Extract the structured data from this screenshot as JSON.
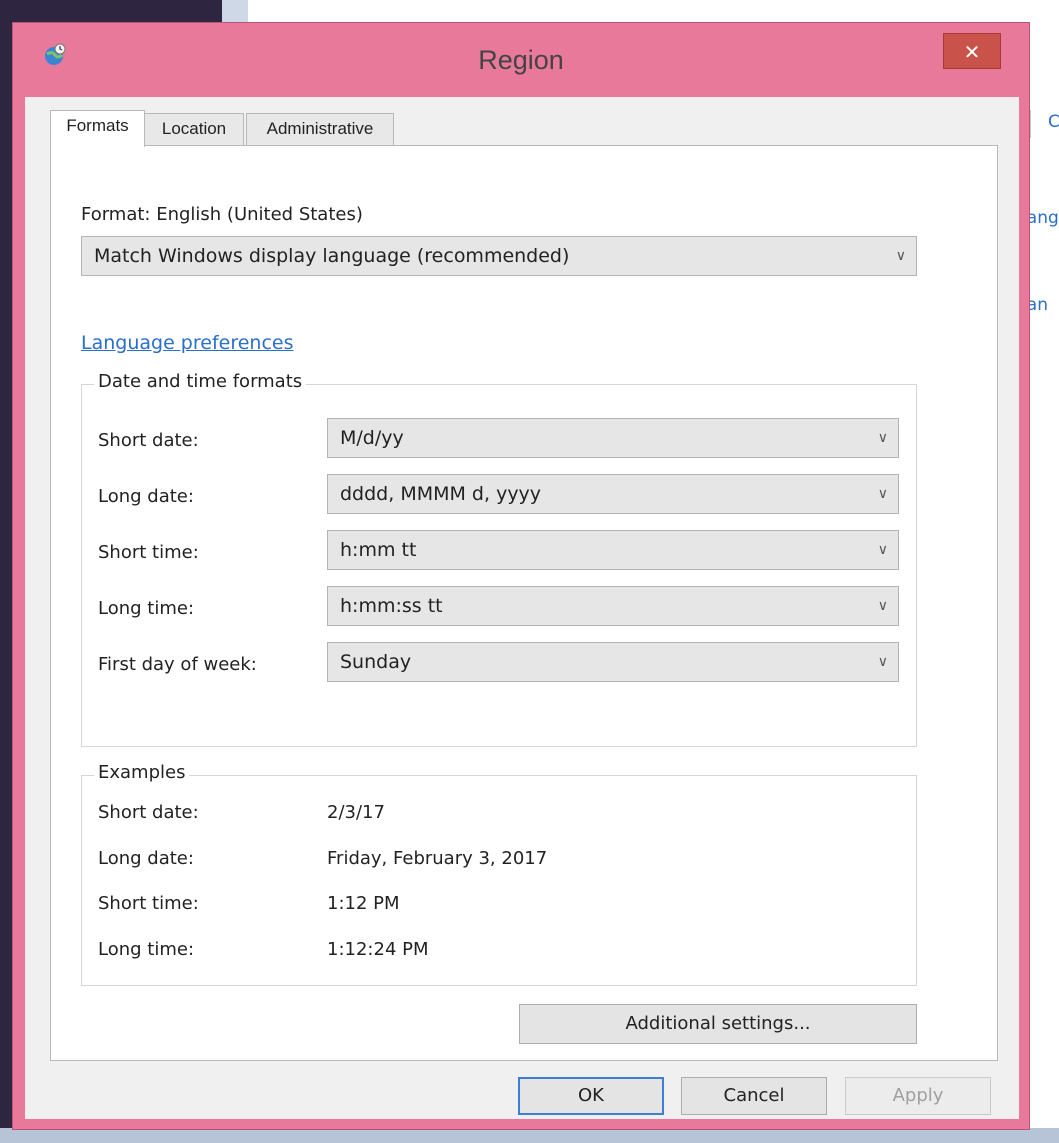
{
  "background": {
    "link_1": "hang",
    "link_2": "han",
    "link_3": "C"
  },
  "dialog": {
    "title": "Region",
    "close_glyph": "✕"
  },
  "tabs": [
    {
      "label": "Formats",
      "active": true
    },
    {
      "label": "Location",
      "active": false
    },
    {
      "label": "Administrative",
      "active": false
    }
  ],
  "formats": {
    "format_label": "Format: English (United States)",
    "format_value": "Match Windows display language (recommended)",
    "language_link": "Language preferences",
    "date_time_group": {
      "title": "Date and time formats",
      "rows": [
        {
          "label": "Short date:",
          "value": "M/d/yy"
        },
        {
          "label": "Long date:",
          "value": "dddd, MMMM d, yyyy"
        },
        {
          "label": "Short time:",
          "value": "h:mm tt"
        },
        {
          "label": "Long time:",
          "value": "h:mm:ss tt"
        },
        {
          "label": "First day of week:",
          "value": "Sunday"
        }
      ]
    },
    "examples_group": {
      "title": "Examples",
      "rows": [
        {
          "label": "Short date:",
          "value": "2/3/17"
        },
        {
          "label": "Long date:",
          "value": "Friday, February 3, 2017"
        },
        {
          "label": "Short time:",
          "value": "1:12 PM"
        },
        {
          "label": "Long time:",
          "value": "1:12:24 PM"
        }
      ]
    },
    "additional_settings": "Additional settings..."
  },
  "buttons": {
    "ok": "OK",
    "cancel": "Cancel",
    "apply": "Apply"
  },
  "colors": {
    "frame": "#e8799b",
    "link": "#2a6fc9",
    "close": "#c9524a"
  },
  "icons": {
    "title": "globe-clock-icon",
    "dropdown": "chevron-down-icon"
  }
}
